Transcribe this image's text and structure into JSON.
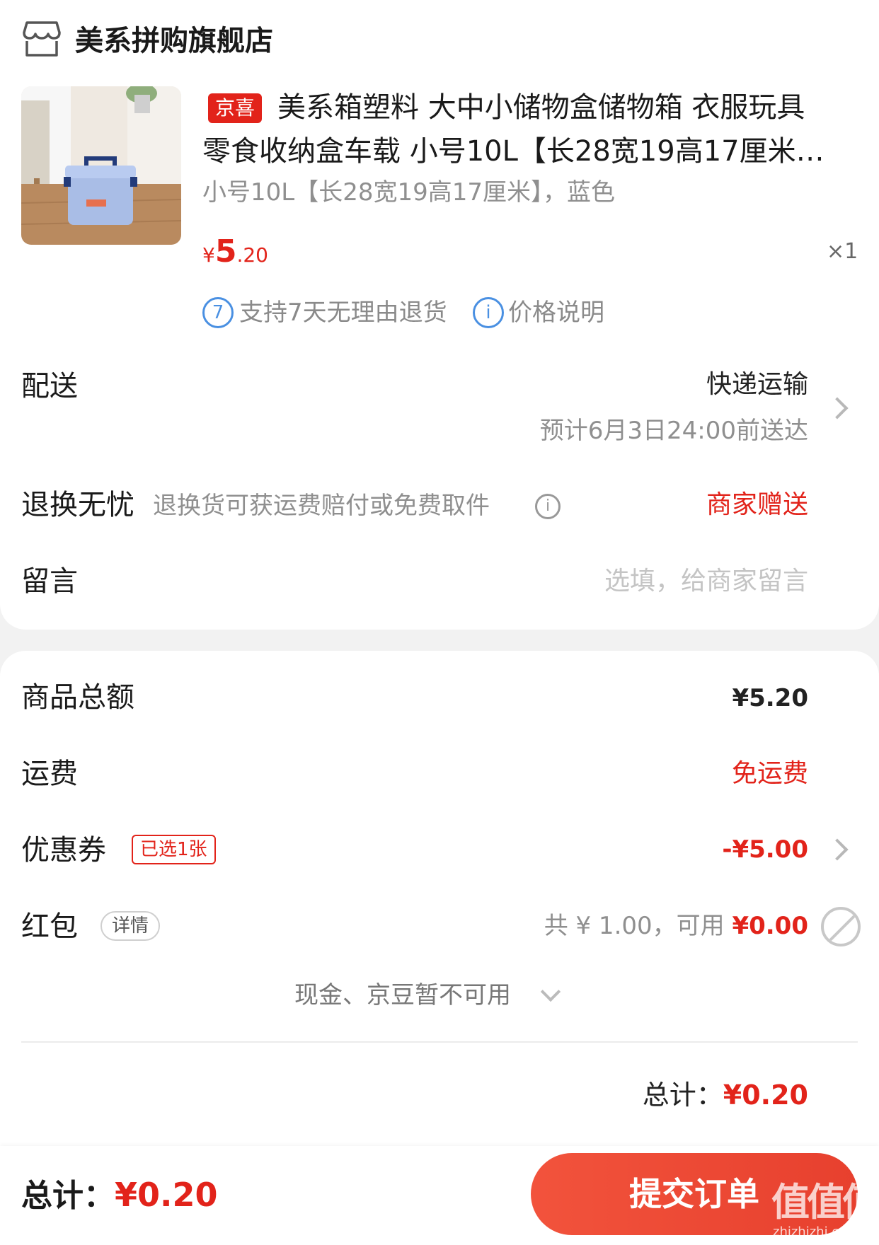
{
  "store": {
    "name": "美系拼购旗舰店",
    "icon": "store-icon"
  },
  "product": {
    "tag": "京喜",
    "title_line1": "美系箱塑料 大中小储物盒储物箱 衣服玩具",
    "title_line2": "零食收纳盒车载 小号10L【长28宽19高17厘米…",
    "spec": "小号10L【长28宽19高17厘米】，蓝色",
    "price_symbol": "¥",
    "price_int": "5",
    "price_dec": ".20",
    "qty": "×1",
    "services": [
      {
        "icon_text": "7",
        "icon": "seven-day-icon",
        "label": "支持7天无理由退货"
      },
      {
        "icon_text": "i",
        "icon": "info-icon",
        "label": "价格说明"
      }
    ]
  },
  "delivery": {
    "label": "配送",
    "method": "快递运输",
    "eta": "预计6月3日24:00前送达"
  },
  "return": {
    "label": "退换无忧",
    "desc": "退换货可获运费赔付或免费取件",
    "info_icon_text": "i",
    "value": "商家赠送"
  },
  "message": {
    "label": "留言",
    "placeholder": "选填，给商家留言"
  },
  "summary": {
    "goods_total_label": "商品总额",
    "goods_total": "¥5.20",
    "shipping_label": "运费",
    "shipping_value": "免运费",
    "coupon_label": "优惠券",
    "coupon_chip": "已选1张",
    "coupon_value": "-¥5.00",
    "redpacket_label": "红包",
    "redpacket_chip": "详情",
    "redpacket_total": "共 ¥ 1.00，可用 ",
    "redpacket_available": "¥0.00",
    "cash_note": "现金、京豆暂不可用",
    "total_label": "总计：",
    "total_value": "¥0.20"
  },
  "bottom": {
    "total_label": "总计：",
    "total_value": "¥0.20",
    "submit": "提交订单"
  },
  "watermark": {
    "main": "值值值",
    "sub": "zhizhizhi.com"
  },
  "colors": {
    "accent": "#e2231a",
    "button": "#f2533c",
    "service_blue": "#4a90e2",
    "background": "#f2f2f2"
  }
}
